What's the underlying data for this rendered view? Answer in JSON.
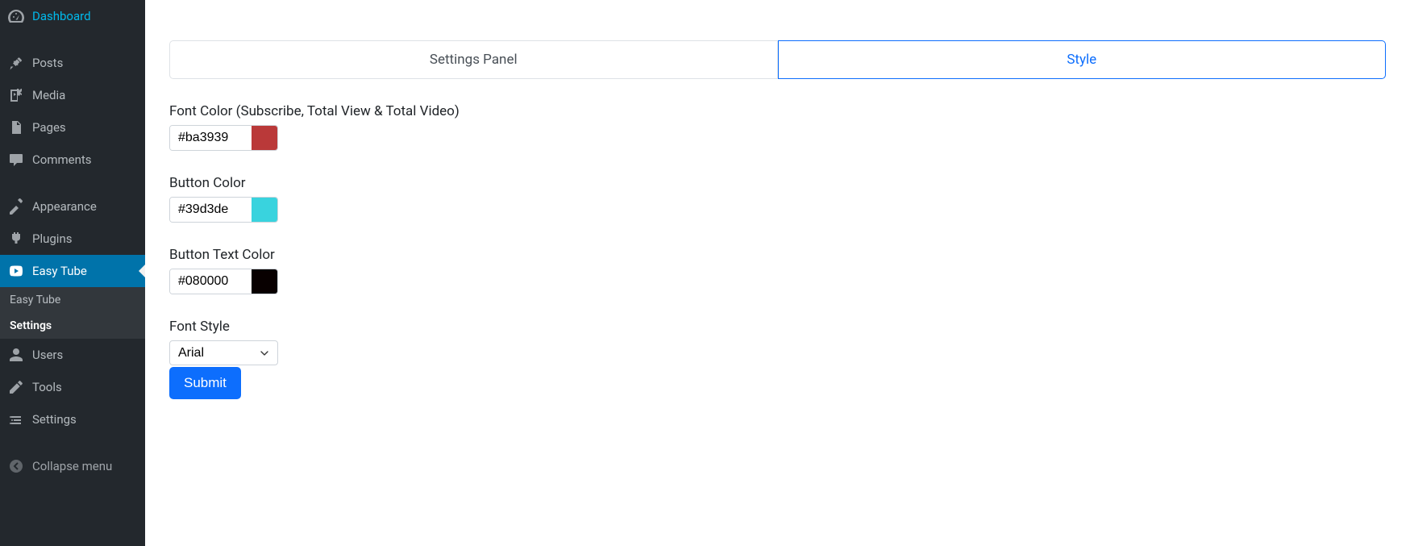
{
  "sidebar": {
    "items": [
      {
        "label": "Dashboard",
        "icon": "dashboard-icon"
      },
      {
        "label": "Posts",
        "icon": "pin-icon"
      },
      {
        "label": "Media",
        "icon": "media-icon"
      },
      {
        "label": "Pages",
        "icon": "pages-icon"
      },
      {
        "label": "Comments",
        "icon": "comments-icon"
      },
      {
        "label": "Appearance",
        "icon": "appearance-icon"
      },
      {
        "label": "Plugins",
        "icon": "plugins-icon"
      },
      {
        "label": "Easy Tube",
        "icon": "youtube-icon"
      },
      {
        "label": "Users",
        "icon": "users-icon"
      },
      {
        "label": "Tools",
        "icon": "tools-icon"
      },
      {
        "label": "Settings",
        "icon": "settings-icon"
      },
      {
        "label": "Collapse menu",
        "icon": "collapse-icon"
      }
    ],
    "submenu": [
      {
        "label": "Easy Tube"
      },
      {
        "label": "Settings"
      }
    ]
  },
  "tabs": [
    {
      "label": "Settings Panel"
    },
    {
      "label": "Style"
    }
  ],
  "form": {
    "font_color_label": "Font Color (Subscribe, Total View & Total Video)",
    "font_color_value": "#ba3939",
    "button_color_label": "Button Color",
    "button_color_value": "#39d3de",
    "button_text_color_label": "Button Text Color",
    "button_text_color_value": "#080000",
    "font_style_label": "Font Style",
    "font_style_value": "Arial",
    "submit_label": "Submit"
  },
  "colors": {
    "font_color_swatch": "#ba3939",
    "button_color_swatch": "#39d3de",
    "button_text_color_swatch": "#080000"
  }
}
